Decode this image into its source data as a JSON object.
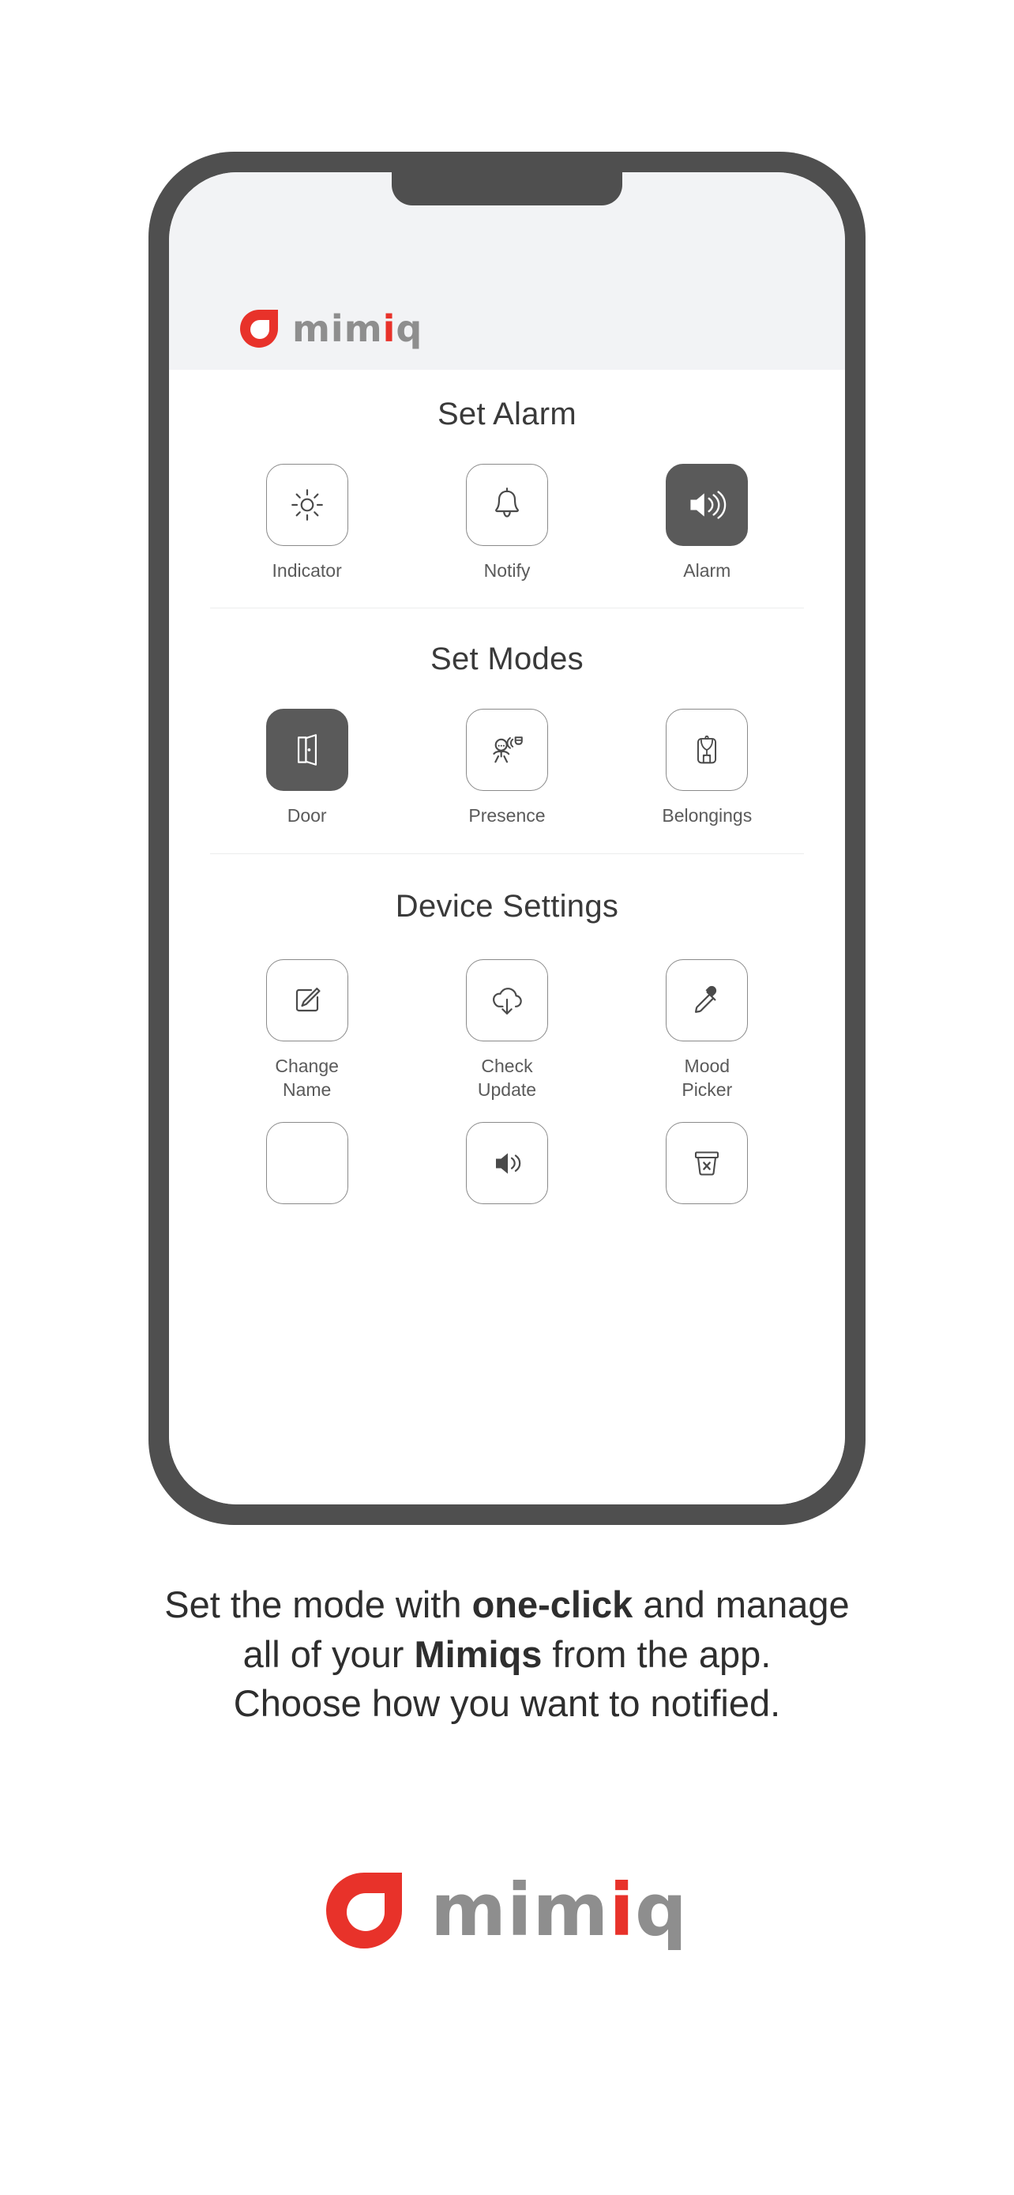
{
  "brand": {
    "name": "mimiq",
    "logo_mark": "mimiq-logo-mark",
    "word_gray_1": "mim",
    "word_red": "i",
    "word_gray_2": "q",
    "accent_color": "#e8322a",
    "gray_color": "#8e8e8e"
  },
  "device_frame": {
    "color": "#4f4f4f",
    "screen_background": "#ffffff",
    "header_background": "#f2f3f5"
  },
  "app": {
    "sections": [
      {
        "id": "set-alarm",
        "title": "Set Alarm",
        "rows": [
          {
            "tiles": [
              {
                "id": "indicator",
                "label": "Indicator",
                "icon": "sun-icon",
                "selected": false
              },
              {
                "id": "notify",
                "label": "Notify",
                "icon": "bell-icon",
                "selected": false
              },
              {
                "id": "alarm",
                "label": "Alarm",
                "icon": "speaker-waves-icon",
                "selected": true
              }
            ]
          }
        ]
      },
      {
        "id": "set-modes",
        "title": "Set Modes",
        "rows": [
          {
            "tiles": [
              {
                "id": "door",
                "label": "Door",
                "icon": "open-door-icon",
                "selected": true
              },
              {
                "id": "presence",
                "label": "Presence",
                "icon": "motion-sensor-icon",
                "selected": false
              },
              {
                "id": "belongings",
                "label": "Belongings",
                "icon": "backpack-icon",
                "selected": false
              }
            ]
          }
        ]
      },
      {
        "id": "device-settings",
        "title": "Device Settings",
        "rows": [
          {
            "tiles": [
              {
                "id": "change-name",
                "label": "Change\nName",
                "icon": "edit-pencil-icon",
                "selected": false
              },
              {
                "id": "check-update",
                "label": "Check\nUpdate",
                "icon": "cloud-download-icon",
                "selected": false
              },
              {
                "id": "mood-picker",
                "label": "Mood\nPicker",
                "icon": "eyedropper-icon",
                "selected": false
              }
            ]
          },
          {
            "tiles": [
              {
                "id": "blank",
                "label": "",
                "icon": "none",
                "selected": false
              },
              {
                "id": "volume",
                "label": "",
                "icon": "speaker-volume-icon",
                "selected": false
              },
              {
                "id": "delete",
                "label": "",
                "icon": "trash-x-icon",
                "selected": false
              }
            ]
          }
        ]
      }
    ]
  },
  "caption": {
    "line1_a": "Set the mode with ",
    "line1_b": "one-click",
    "line1_c": " and manage",
    "line2_a": "all of your ",
    "line2_b": "Mimiqs",
    "line2_c": " from the app.",
    "line3": "Choose how you want to notified."
  }
}
